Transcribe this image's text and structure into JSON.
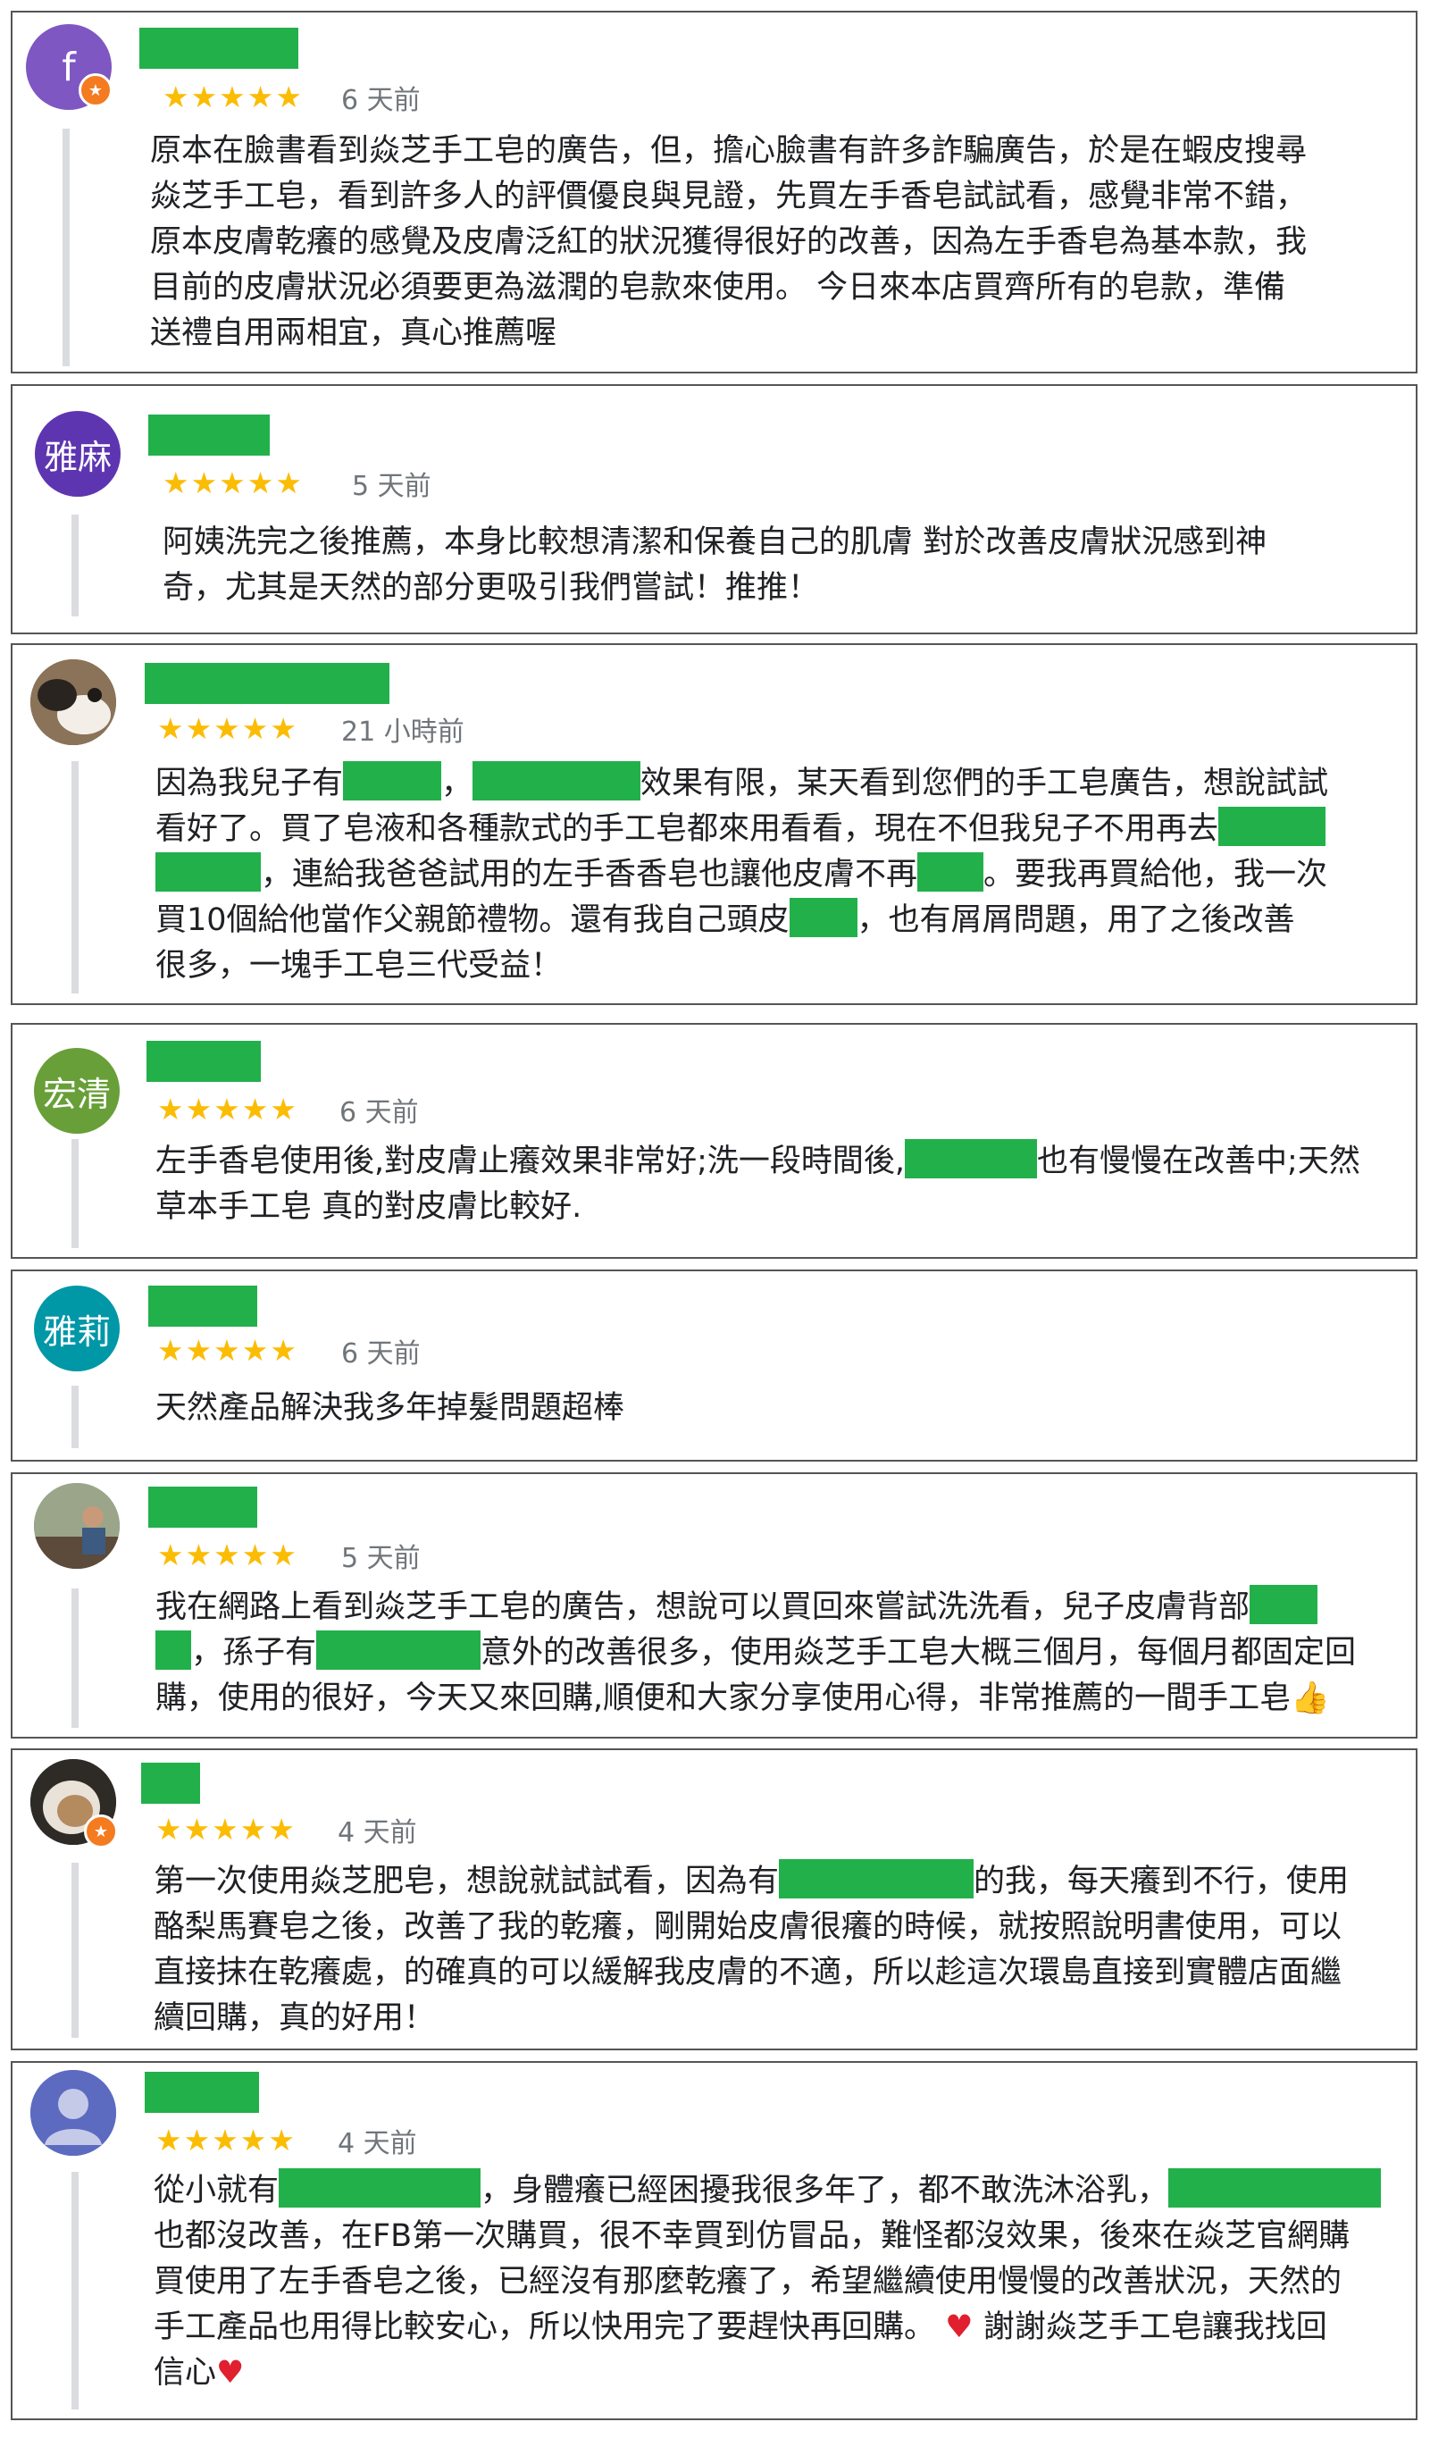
{
  "reviews": [
    {
      "avatar_text": "f",
      "stars": "★★★★★",
      "time": "6 天前",
      "lines": [
        "原本在臉書看到焱芝手工皂的廣告，但，擔心臉書有許多詐騙廣告，於是在蝦皮搜尋",
        "焱芝手工皂，看到許多人的評價優良與見證，先買左手香皂試試看，感覺非常不錯，",
        "原本皮膚乾癢的感覺及皮膚泛紅的狀況獲得很好的改善，因為左手香皂為基本款，我",
        "目前的皮膚狀況必須要更為滋潤的皂款來使用。 今日來本店買齊所有的皂款，準備",
        "送禮自用兩相宜，真心推薦喔"
      ]
    },
    {
      "avatar_text": "雅麻",
      "stars": "★★★★★",
      "time": "5 天前",
      "lines": [
        "阿姨洗完之後推薦，本身比較想清潔和保養自己的肌膚 對於改善皮膚狀況感到神",
        "奇，尤其是天然的部分更吸引我們嘗試！推推！"
      ]
    },
    {
      "stars": "★★★★★",
      "time": "21 小時前",
      "l1a": "因為我兒子有",
      "l1b": "，",
      "l1c": "效果有限，某天看到您們的手工皂廣告，想說試試",
      "l2a": "看好了。買了皂液和各種款式的手工皂都來用看看，現在不但我兒子不用再去",
      "l3a": "，連給我爸爸試用的左手香香皂也讓他皮膚不再",
      "l3b": "。要我再買給他，我一次",
      "l4a": "買10個給他當作父親節禮物。還有我自己頭皮",
      "l4b": "，也有屑屑問題，用了之後改善",
      "l5a": "很多，一塊手工皂三代受益！"
    },
    {
      "avatar_text": "宏清",
      "stars": "★★★★★",
      "time": "6 天前",
      "l1a": "左手香皂使用後,對皮膚止癢效果非常好;洗一段時間後,",
      "l1b": "也有慢慢在改善中;天然",
      "l2a": "草本手工皂 真的對皮膚比較好."
    },
    {
      "avatar_text": "雅莉",
      "stars": "★★★★★",
      "time": "6 天前",
      "lines": [
        "天然產品解決我多年掉髮問題超棒"
      ]
    },
    {
      "stars": "★★★★★",
      "time": "5 天前",
      "l1a": "我在網路上看到焱芝手工皂的廣告，想說可以買回來嘗試洗洗看，兒子皮膚背部",
      "l2a": "，孫子有",
      "l2b": "意外的改善很多，使用焱芝手工皂大概三個月，每個月都固定回",
      "l3a": "購，使用的很好，今天又來回購,順便和大家分享使用心得，非常推薦的一間手工皂",
      "emoji": "👍"
    },
    {
      "stars": "★★★★★",
      "time": "4 天前",
      "l1a": "第一次使用焱芝肥皂，想說就試試看，因為有",
      "l1b": "的我，每天癢到不行，使用",
      "l2a": "酪梨馬賽皂之後，改善了我的乾癢，剛開始皮膚很癢的時候，就按照說明書使用，可以",
      "l3a": "直接抹在乾癢處，的確真的可以緩解我皮膚的不適，所以趁這次環島直接到實體店面繼",
      "l4a": "續回購，真的好用！"
    },
    {
      "stars": "★★★★★",
      "time": "4 天前",
      "l1a": "從小就有",
      "l1b": "，身體癢已經困擾我很多年了，都不敢洗沐浴乳，",
      "l2a": "也都沒改善，在FB第一次購買，很不幸買到仿冒品，難怪都沒效果，後來在焱芝官網購",
      "l3a": "買使用了左手香皂之後，已經沒有那麼乾癢了，希望繼續使用慢慢的改善狀況，天然的",
      "l4a": "手工產品也用得比較安心，所以快用完了要趕快再回購。",
      "l4b": "謝謝焱芝手工皂讓我找回",
      "l5a": "信心",
      "heart": "♥"
    }
  ],
  "colors": {
    "redaction": "#22b04b",
    "star": "#fbbc04",
    "timestamp": "#70757a"
  }
}
